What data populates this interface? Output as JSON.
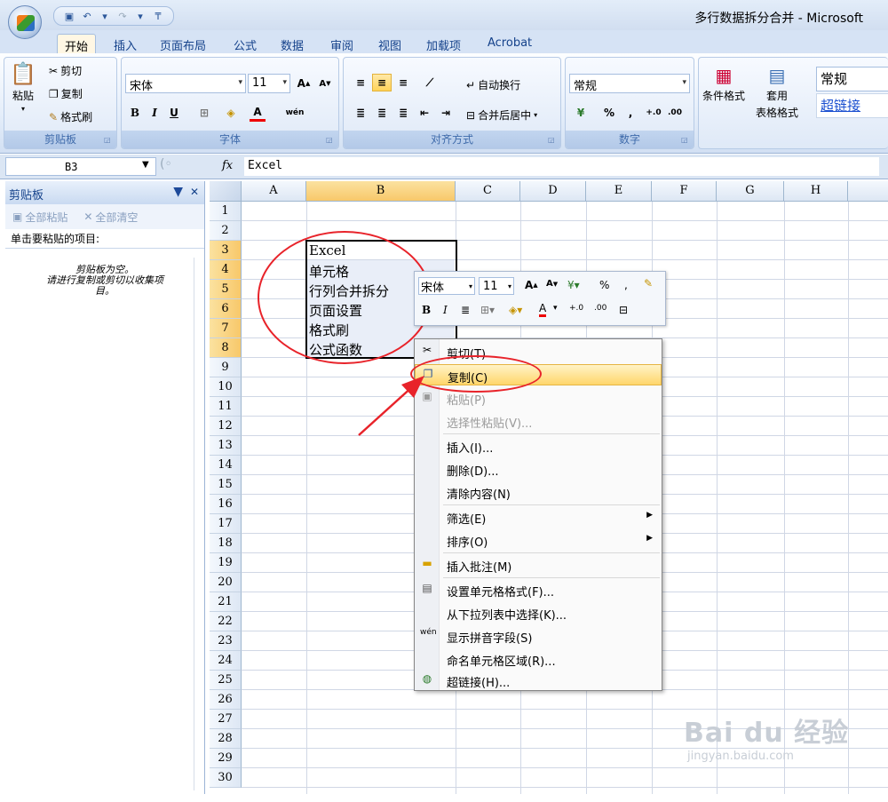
{
  "window": {
    "title": "多行数据拆分合并 - Microsoft"
  },
  "ribbon_tabs": [
    "开始",
    "插入",
    "页面布局",
    "公式",
    "数据",
    "审阅",
    "视图",
    "加载项",
    "Acrobat"
  ],
  "clipboard_group": {
    "paste": "粘贴",
    "cut": "剪切",
    "copy": "复制",
    "format_painter": "格式刷",
    "label": "剪贴板"
  },
  "font_group": {
    "font_name": "宋体",
    "font_size": "11",
    "label": "字体",
    "bold": "B",
    "italic": "I",
    "underline": "U"
  },
  "align_group": {
    "wrap": "自动换行",
    "merge": "合并后居中",
    "label": "对齐方式"
  },
  "number_group": {
    "format": "常规",
    "label": "数字",
    "percent": "%",
    "comma": ","
  },
  "styles_group": {
    "cond_format": "条件格式",
    "table_style_1": "套用",
    "table_style_2": "表格格式",
    "style_normal": "常规",
    "style_hyperlink": "超链接"
  },
  "formula_bar": {
    "name_box": "B3",
    "fx": "fx",
    "value": "Excel"
  },
  "clipboard_pane": {
    "title": "剪贴板",
    "paste_all": "全部粘贴",
    "clear_all": "全部清空",
    "instruction": "单击要粘贴的项目:",
    "empty_line1": "剪贴板为空。",
    "empty_line2": "请进行复制或剪切以收集项",
    "empty_line3": "目。"
  },
  "columns": [
    "A",
    "B",
    "C",
    "D",
    "E",
    "F",
    "G",
    "H"
  ],
  "rows": [
    "1",
    "2",
    "3",
    "4",
    "5",
    "6",
    "7",
    "8",
    "9",
    "10",
    "11",
    "12",
    "13",
    "14",
    "15",
    "16",
    "17",
    "18",
    "19",
    "20",
    "21",
    "22",
    "23",
    "24",
    "25",
    "26",
    "27",
    "28",
    "29",
    "30"
  ],
  "cells": [
    "Excel",
    "单元格",
    "行列合并拆分",
    "页面设置",
    "格式刷",
    "公式函数"
  ],
  "mini_toolbar": {
    "font": "宋体",
    "size": "11",
    "percent": "%",
    "comma": ","
  },
  "context_menu": {
    "cut": "剪切(T)",
    "copy": "复制(C)",
    "paste": "粘贴(P)",
    "paste_special": "选择性粘贴(V)...",
    "insert": "插入(I)...",
    "delete": "删除(D)...",
    "clear": "清除内容(N)",
    "filter": "筛选(E)",
    "sort": "排序(O)",
    "insert_comment": "插入批注(M)",
    "format_cells": "设置单元格格式(F)...",
    "pick_list": "从下拉列表中选择(K)...",
    "phonetic": "显示拼音字段(S)",
    "name_range": "命名单元格区域(R)...",
    "hyperlink": "超链接(H)..."
  },
  "watermark": {
    "brand": "Bai du 经验",
    "url": "jingyan.baidu.com"
  },
  "colors": {
    "accent": "#15428b",
    "annotation": "#e8232a",
    "hover": "#ffd66b"
  }
}
